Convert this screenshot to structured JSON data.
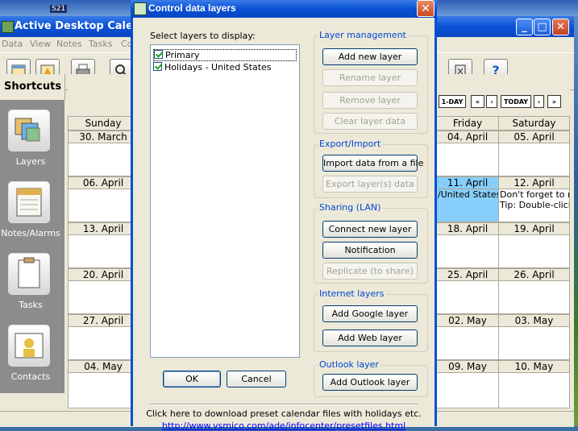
{
  "desktop": {
    "icon_label": "S21"
  },
  "app": {
    "title": "Active Desktop Calenda",
    "menu": [
      "Data",
      "View",
      "Notes",
      "Tasks",
      "Co"
    ],
    "min": "_",
    "max": "□",
    "close": "✕"
  },
  "toolbar": {
    "help_label": "?"
  },
  "shortcuts": {
    "title": "Shortcuts",
    "items": [
      {
        "label": "Layers"
      },
      {
        "label": "Notes/Alarms"
      },
      {
        "label": "Tasks"
      },
      {
        "label": "Contacts"
      }
    ]
  },
  "calendar": {
    "nav": {
      "one_day": "1-DAY",
      "first": "«",
      "prev": "‹",
      "today": "TODAY",
      "next": "›",
      "last": "»"
    },
    "day_names": [
      "Sunday",
      "Friday",
      "Saturday"
    ],
    "sunday_dates": [
      "30. March",
      "06. April",
      "13. April",
      "20. April",
      "27. April",
      "04. May"
    ],
    "friday_dates": [
      "04. April",
      "11. April",
      "18. April",
      "25. April",
      "02. May",
      "09. May"
    ],
    "saturday_dates": [
      "05. April",
      "12. April",
      "19. April",
      "26. April",
      "03. May",
      "10. May"
    ],
    "friday_event": "/United States H",
    "saturday_events": [
      "Don't forget to reg",
      "Tip: Double-click h"
    ]
  },
  "dialog": {
    "title": "Control data layers",
    "close": "✕",
    "select_label": "Select layers to display:",
    "layers": [
      {
        "name": "Primary",
        "checked": true
      },
      {
        "name": "Holidays - United States",
        "checked": true
      }
    ],
    "groups": {
      "layer_management": {
        "title": "Layer management",
        "buttons": [
          "Add new layer",
          "Rename layer",
          "Remove layer",
          "Clear layer data"
        ]
      },
      "export_import": {
        "title": "Export/Import",
        "buttons": [
          "Import data from a file",
          "Export layer(s) data"
        ]
      },
      "sharing": {
        "title": "Sharing (LAN)",
        "buttons": [
          "Connect new layer",
          "Notification",
          "Replicate (to share)"
        ]
      },
      "internet": {
        "title": "Internet layers",
        "buttons": [
          "Add Google layer",
          "Add Web layer"
        ]
      },
      "outlook": {
        "title": "Outlook layer",
        "buttons": [
          "Add Outlook layer"
        ]
      }
    },
    "ok": "OK",
    "cancel": "Cancel",
    "download_text": "Click here to download preset calendar files with holidays etc.",
    "download_link": "http://www.vsmico.com/ade/infocenter/presetfiles.html"
  }
}
